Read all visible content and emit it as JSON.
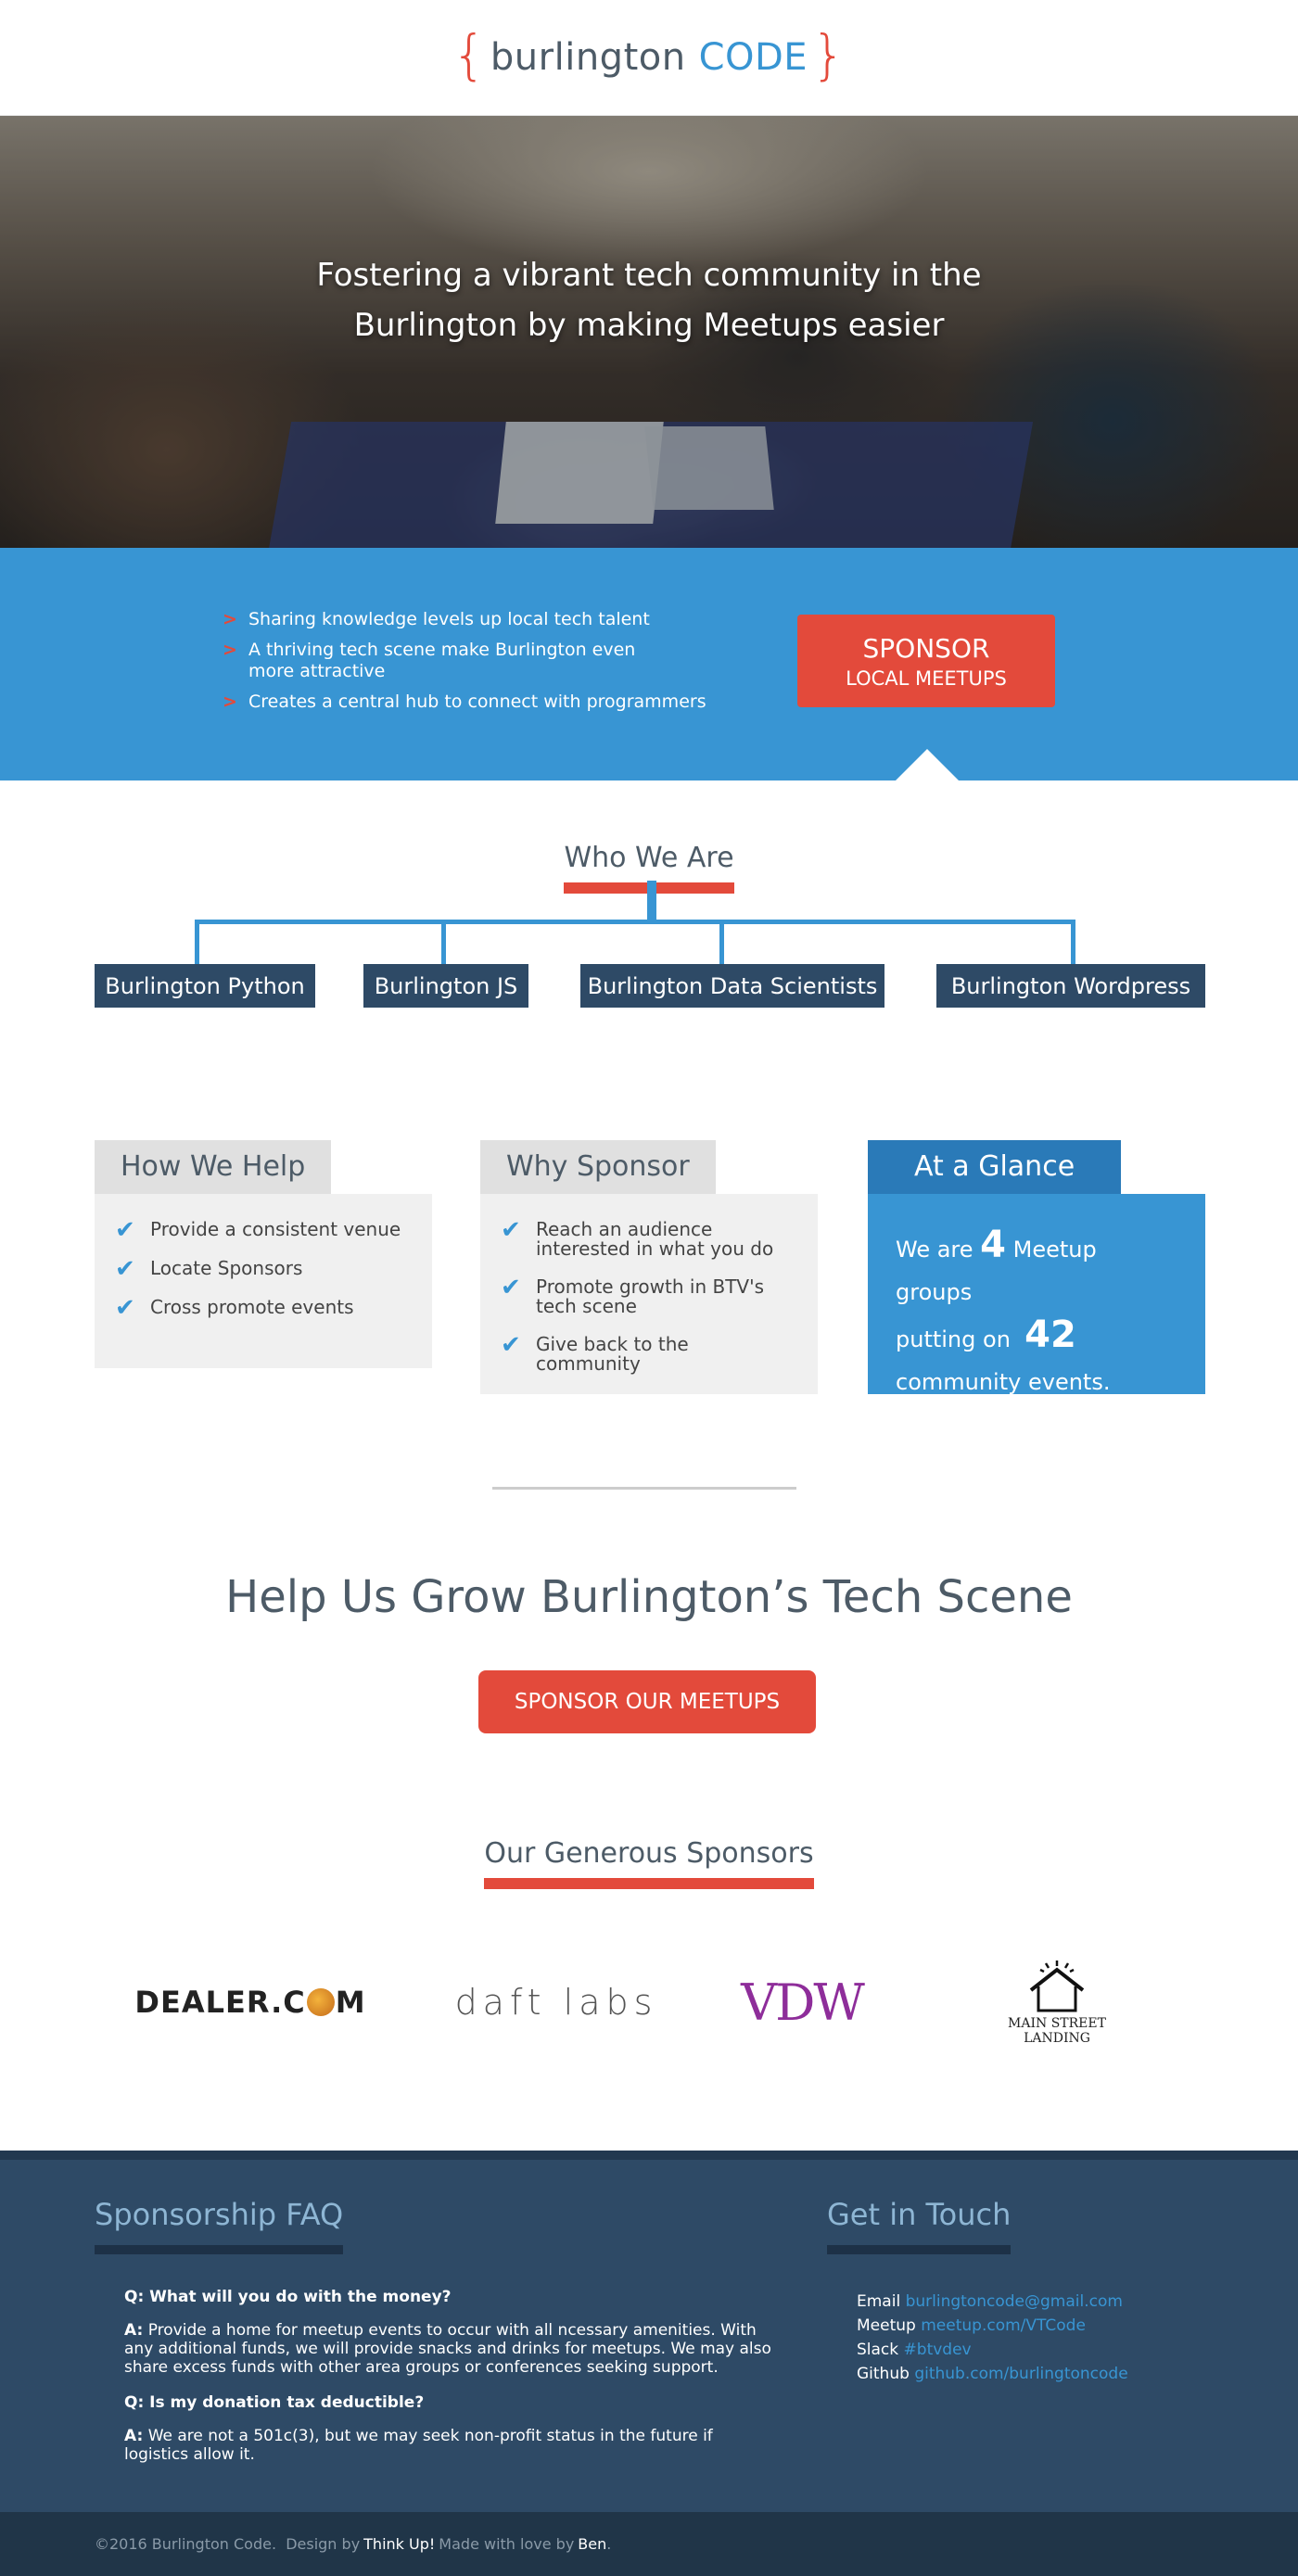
{
  "header": {
    "brace_open": "{",
    "brand_word": "burlington",
    "brand_code": "CODE",
    "brace_close": "}"
  },
  "hero": {
    "line1": "Fostering a vibrant tech community in the",
    "line2": "Burlington by making Meetups easier"
  },
  "benefits": {
    "items": [
      "Sharing knowledge levels up local tech talent",
      "A thriving tech scene make Burlington even more attractive",
      "Creates a central hub to connect with programmers"
    ],
    "arrow": ">",
    "button_line1": "SPONSOR",
    "button_line2": "LOCAL MEETUPS"
  },
  "who": {
    "title": "Who We Are",
    "groups": [
      "Burlington Python",
      "Burlington JS",
      "Burlington Data Scientists",
      "Burlington Wordpress"
    ]
  },
  "help": {
    "title": "How We Help",
    "items": [
      "Provide a consistent venue",
      "Locate Sponsors",
      "Cross promote events"
    ]
  },
  "why": {
    "title": "Why Sponsor",
    "items": [
      "Reach an audience interested in what you do",
      "Promote growth in BTV's tech scene",
      "Give back to the community"
    ]
  },
  "glance": {
    "title": "At a Glance",
    "we_are": "We are",
    "groups_count": "4",
    "meetup_text": "Meetup groups",
    "putting_on": "putting on",
    "events_count": "42",
    "events_text": "community events."
  },
  "grow": {
    "title": "Help Us Grow Burlington’s Tech Scene",
    "button": "SPONSOR OUR MEETUPS"
  },
  "sponsors": {
    "title": "Our Generous Sponsors",
    "dealer": [
      "DEALER.C",
      "M"
    ],
    "daft": "daft labs",
    "vdw": "VDW",
    "msl_line1": "MAIN STREET",
    "msl_line2": "LANDING"
  },
  "faq": {
    "title": "Sponsorship FAQ",
    "q1": "Q: What will you do with the money?",
    "a1_label": "A:",
    "a1": "Provide a home for meetup events to occur with all ncessary amenities. With any additional funds, we will provide snacks and drinks for meetups. We may also share excess funds with other area groups or conferences seeking support.",
    "q2": "Q: Is my donation tax deductible?",
    "a2_label": "A:",
    "a2": "We are not a 501c(3), but we may seek non-profit status in the future if logistics allow it."
  },
  "contact": {
    "title": "Get in Touch",
    "email_label": "Email",
    "email": "burlingtoncode@gmail.com",
    "meetup_label": "Meetup",
    "meetup": "meetup.com/VTCode",
    "slack_label": "Slack",
    "slack": "#btvdev",
    "github_label": "Github",
    "github": "github.com/burlingtoncode"
  },
  "footer": {
    "copyright": "©2016 Burlington Code.",
    "design_by": "Design by",
    "thinkup": "Think Up!",
    "made_with": "Made with love by",
    "ben": "Ben",
    "period": "."
  },
  "colors": {
    "accent_red": "#e34a3b",
    "accent_blue": "#3895d3",
    "navy": "#2e4a66"
  }
}
